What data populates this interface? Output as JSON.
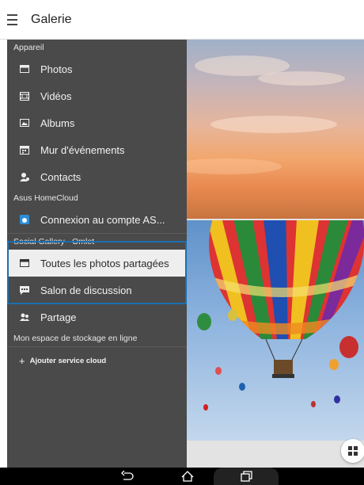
{
  "header": {
    "title": "Galerie",
    "menu_icon": "hamburger-menu-icon"
  },
  "drawer": {
    "sections": {
      "device": "Appareil",
      "homecloud": "Asus HomeCloud",
      "omlet": "Social Gallery - Omlet",
      "storage": "Mon espace de stockage en ligne"
    },
    "device_items": [
      {
        "label": "Photos",
        "icon": "photos-icon"
      },
      {
        "label": "Vidéos",
        "icon": "film-icon"
      },
      {
        "label": "Albums",
        "icon": "albums-icon"
      },
      {
        "label": "Mur d'événements",
        "icon": "calendar-icon"
      },
      {
        "label": "Contacts",
        "icon": "contacts-icon"
      }
    ],
    "homecloud_item": {
      "label": "Connexion au compte AS...",
      "icon": "homecloud-icon"
    },
    "omlet_items": [
      {
        "label": "Toutes les photos partagées",
        "icon": "shared-photos-icon",
        "selected": true
      },
      {
        "label": "Salon de discussion",
        "icon": "chat-icon"
      }
    ],
    "share_item": {
      "label": "Partage",
      "icon": "share-people-icon"
    },
    "add_cloud": "Ajouter service cloud"
  },
  "colors": {
    "drawer_bg": "#4a4a4a",
    "selected_bg": "#eeeeee",
    "highlight_border": "#1b6fb0",
    "homecloud_blue": "#2b8fd8"
  },
  "navbar": {
    "buttons": [
      "back-icon",
      "home-icon",
      "recent-apps-icon"
    ]
  }
}
